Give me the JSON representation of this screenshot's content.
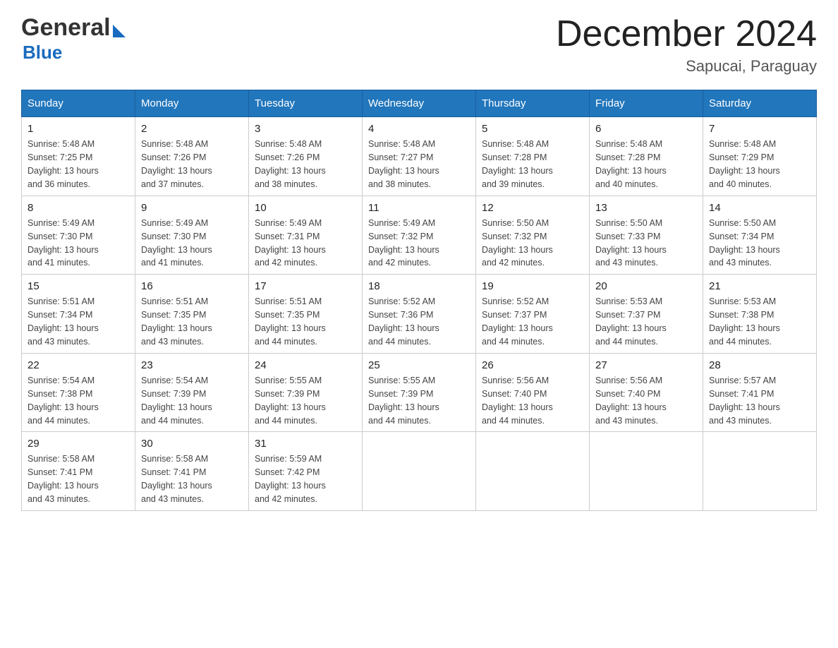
{
  "header": {
    "logo_line1": "General",
    "logo_arrow": "▶",
    "logo_line2": "Blue",
    "calendar_title": "December 2024",
    "calendar_subtitle": "Sapucai, Paraguay"
  },
  "days_of_week": [
    "Sunday",
    "Monday",
    "Tuesday",
    "Wednesday",
    "Thursday",
    "Friday",
    "Saturday"
  ],
  "weeks": [
    [
      {
        "day": "1",
        "sunrise": "5:48 AM",
        "sunset": "7:25 PM",
        "daylight": "13 hours and 36 minutes."
      },
      {
        "day": "2",
        "sunrise": "5:48 AM",
        "sunset": "7:26 PM",
        "daylight": "13 hours and 37 minutes."
      },
      {
        "day": "3",
        "sunrise": "5:48 AM",
        "sunset": "7:26 PM",
        "daylight": "13 hours and 38 minutes."
      },
      {
        "day": "4",
        "sunrise": "5:48 AM",
        "sunset": "7:27 PM",
        "daylight": "13 hours and 38 minutes."
      },
      {
        "day": "5",
        "sunrise": "5:48 AM",
        "sunset": "7:28 PM",
        "daylight": "13 hours and 39 minutes."
      },
      {
        "day": "6",
        "sunrise": "5:48 AM",
        "sunset": "7:28 PM",
        "daylight": "13 hours and 40 minutes."
      },
      {
        "day": "7",
        "sunrise": "5:48 AM",
        "sunset": "7:29 PM",
        "daylight": "13 hours and 40 minutes."
      }
    ],
    [
      {
        "day": "8",
        "sunrise": "5:49 AM",
        "sunset": "7:30 PM",
        "daylight": "13 hours and 41 minutes."
      },
      {
        "day": "9",
        "sunrise": "5:49 AM",
        "sunset": "7:30 PM",
        "daylight": "13 hours and 41 minutes."
      },
      {
        "day": "10",
        "sunrise": "5:49 AM",
        "sunset": "7:31 PM",
        "daylight": "13 hours and 42 minutes."
      },
      {
        "day": "11",
        "sunrise": "5:49 AM",
        "sunset": "7:32 PM",
        "daylight": "13 hours and 42 minutes."
      },
      {
        "day": "12",
        "sunrise": "5:50 AM",
        "sunset": "7:32 PM",
        "daylight": "13 hours and 42 minutes."
      },
      {
        "day": "13",
        "sunrise": "5:50 AM",
        "sunset": "7:33 PM",
        "daylight": "13 hours and 43 minutes."
      },
      {
        "day": "14",
        "sunrise": "5:50 AM",
        "sunset": "7:34 PM",
        "daylight": "13 hours and 43 minutes."
      }
    ],
    [
      {
        "day": "15",
        "sunrise": "5:51 AM",
        "sunset": "7:34 PM",
        "daylight": "13 hours and 43 minutes."
      },
      {
        "day": "16",
        "sunrise": "5:51 AM",
        "sunset": "7:35 PM",
        "daylight": "13 hours and 43 minutes."
      },
      {
        "day": "17",
        "sunrise": "5:51 AM",
        "sunset": "7:35 PM",
        "daylight": "13 hours and 44 minutes."
      },
      {
        "day": "18",
        "sunrise": "5:52 AM",
        "sunset": "7:36 PM",
        "daylight": "13 hours and 44 minutes."
      },
      {
        "day": "19",
        "sunrise": "5:52 AM",
        "sunset": "7:37 PM",
        "daylight": "13 hours and 44 minutes."
      },
      {
        "day": "20",
        "sunrise": "5:53 AM",
        "sunset": "7:37 PM",
        "daylight": "13 hours and 44 minutes."
      },
      {
        "day": "21",
        "sunrise": "5:53 AM",
        "sunset": "7:38 PM",
        "daylight": "13 hours and 44 minutes."
      }
    ],
    [
      {
        "day": "22",
        "sunrise": "5:54 AM",
        "sunset": "7:38 PM",
        "daylight": "13 hours and 44 minutes."
      },
      {
        "day": "23",
        "sunrise": "5:54 AM",
        "sunset": "7:39 PM",
        "daylight": "13 hours and 44 minutes."
      },
      {
        "day": "24",
        "sunrise": "5:55 AM",
        "sunset": "7:39 PM",
        "daylight": "13 hours and 44 minutes."
      },
      {
        "day": "25",
        "sunrise": "5:55 AM",
        "sunset": "7:39 PM",
        "daylight": "13 hours and 44 minutes."
      },
      {
        "day": "26",
        "sunrise": "5:56 AM",
        "sunset": "7:40 PM",
        "daylight": "13 hours and 44 minutes."
      },
      {
        "day": "27",
        "sunrise": "5:56 AM",
        "sunset": "7:40 PM",
        "daylight": "13 hours and 43 minutes."
      },
      {
        "day": "28",
        "sunrise": "5:57 AM",
        "sunset": "7:41 PM",
        "daylight": "13 hours and 43 minutes."
      }
    ],
    [
      {
        "day": "29",
        "sunrise": "5:58 AM",
        "sunset": "7:41 PM",
        "daylight": "13 hours and 43 minutes."
      },
      {
        "day": "30",
        "sunrise": "5:58 AM",
        "sunset": "7:41 PM",
        "daylight": "13 hours and 43 minutes."
      },
      {
        "day": "31",
        "sunrise": "5:59 AM",
        "sunset": "7:42 PM",
        "daylight": "13 hours and 42 minutes."
      },
      null,
      null,
      null,
      null
    ]
  ],
  "labels": {
    "sunrise": "Sunrise:",
    "sunset": "Sunset:",
    "daylight": "Daylight:"
  }
}
